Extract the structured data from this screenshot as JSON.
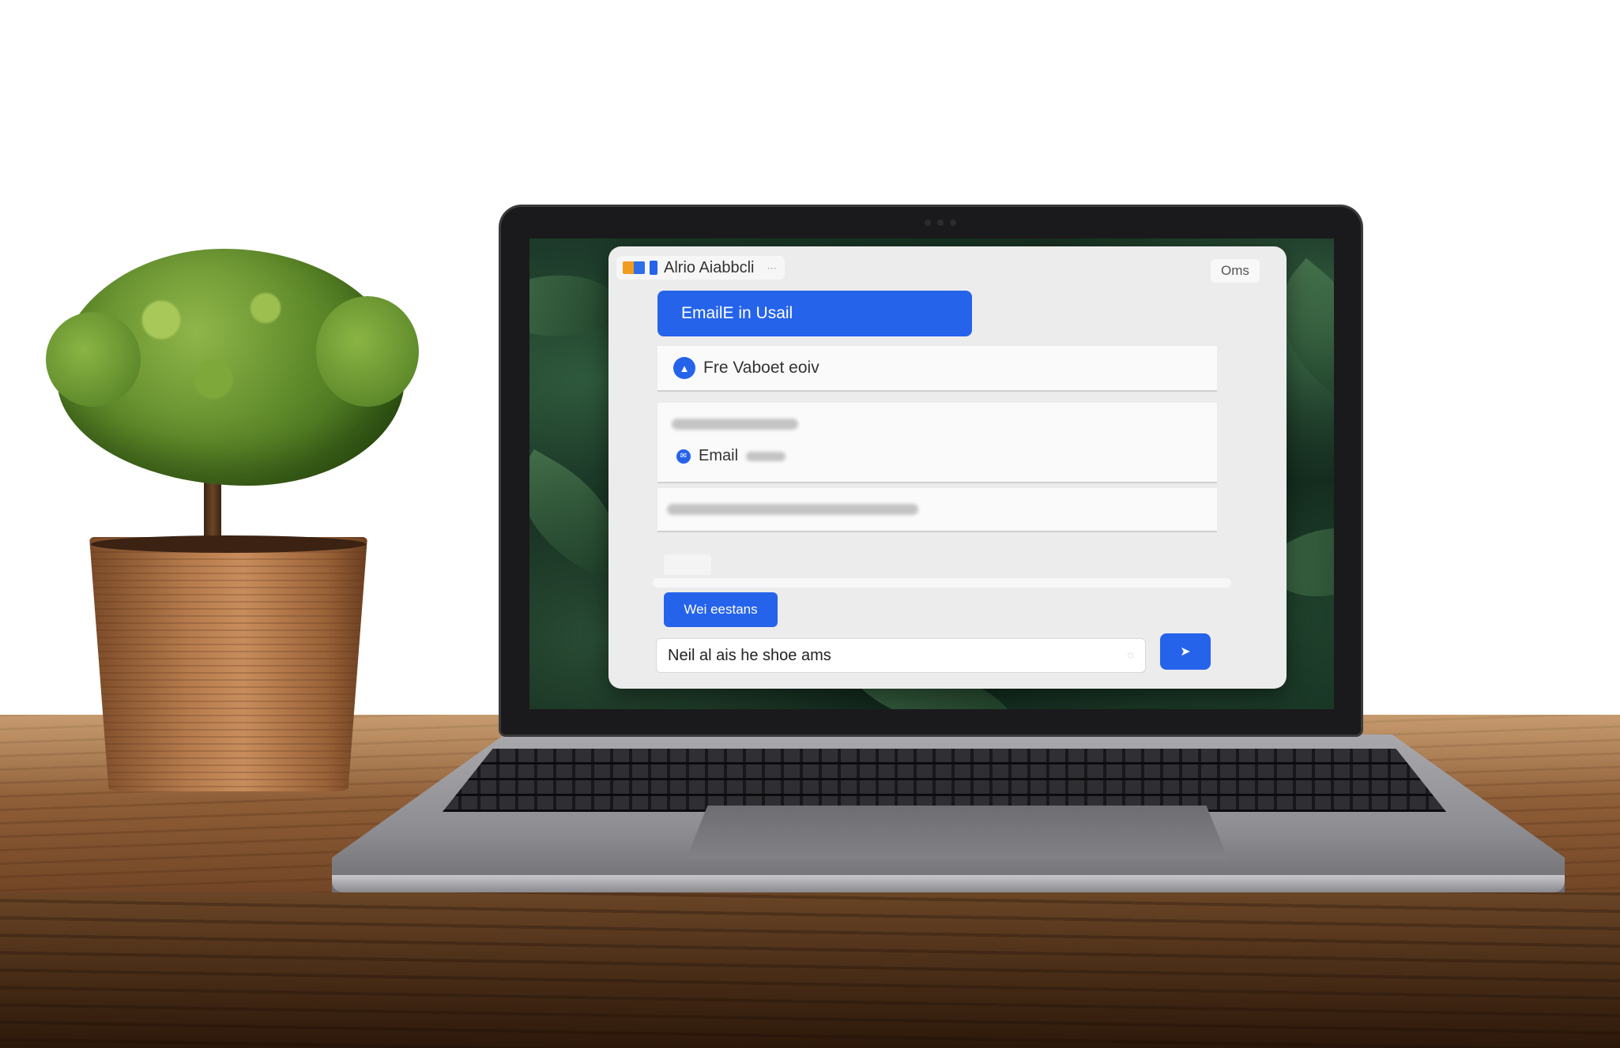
{
  "app": {
    "title": "Alrio Aiabbcli",
    "title_close": "···",
    "corner_button": "Oms",
    "primary_button": "EmailE in Usail",
    "card_row_label": "Fre Vaboet eoiv",
    "card_row_icon": "user-icon",
    "email_label": "Email",
    "email_icon": "mail-icon",
    "secondary_button": "Wei eestans",
    "message_input_value": "Neil al ais he shoe ams",
    "input_icon": "clear-icon",
    "send_button": "send",
    "accent_color": "#2563eb"
  }
}
